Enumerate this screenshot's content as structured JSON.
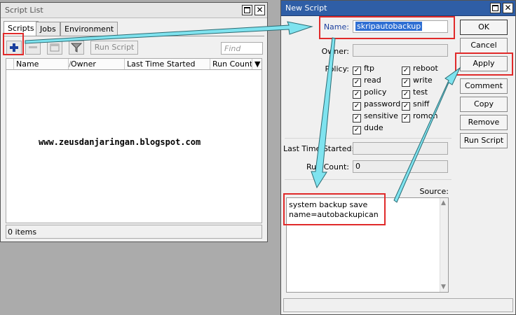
{
  "script_list": {
    "title": "Script List",
    "tabs": [
      "Scripts",
      "Jobs",
      "Environment"
    ],
    "toolbar": {
      "run_script_label": "Run Script",
      "find_placeholder": "Find"
    },
    "columns": [
      "Name",
      "Owner",
      "Last Time Started",
      "Run Count"
    ],
    "status": "0 items"
  },
  "watermark": "www.zeusdanjaringan.blogspot.com",
  "new_script": {
    "title": "New Script",
    "name_label": "Name:",
    "name_value": "skripautobackup",
    "owner_label": "Owner:",
    "owner_value": "",
    "policy_label": "Policy:",
    "policies": [
      {
        "label": "ftp",
        "checked": true
      },
      {
        "label": "reboot",
        "checked": true
      },
      {
        "label": "read",
        "checked": true
      },
      {
        "label": "write",
        "checked": true
      },
      {
        "label": "policy",
        "checked": true
      },
      {
        "label": "test",
        "checked": true
      },
      {
        "label": "password",
        "checked": true
      },
      {
        "label": "sniff",
        "checked": true
      },
      {
        "label": "sensitive",
        "checked": true
      },
      {
        "label": "romon",
        "checked": true
      },
      {
        "label": "dude",
        "checked": true
      }
    ],
    "last_started_label": "Last Time Started:",
    "last_started_value": "",
    "run_count_label": "Run Count:",
    "run_count_value": "0",
    "source_label": "Source:",
    "source_line1": "system backup save",
    "source_line2": "name=autobackupican",
    "buttons": [
      "OK",
      "Cancel",
      "Apply",
      "Comment",
      "Copy",
      "Remove",
      "Run Script"
    ]
  },
  "colors": {
    "highlight": "#e02a2a",
    "arrow": "#7fe3ef",
    "titlebar_active": "#2f5ea6"
  }
}
